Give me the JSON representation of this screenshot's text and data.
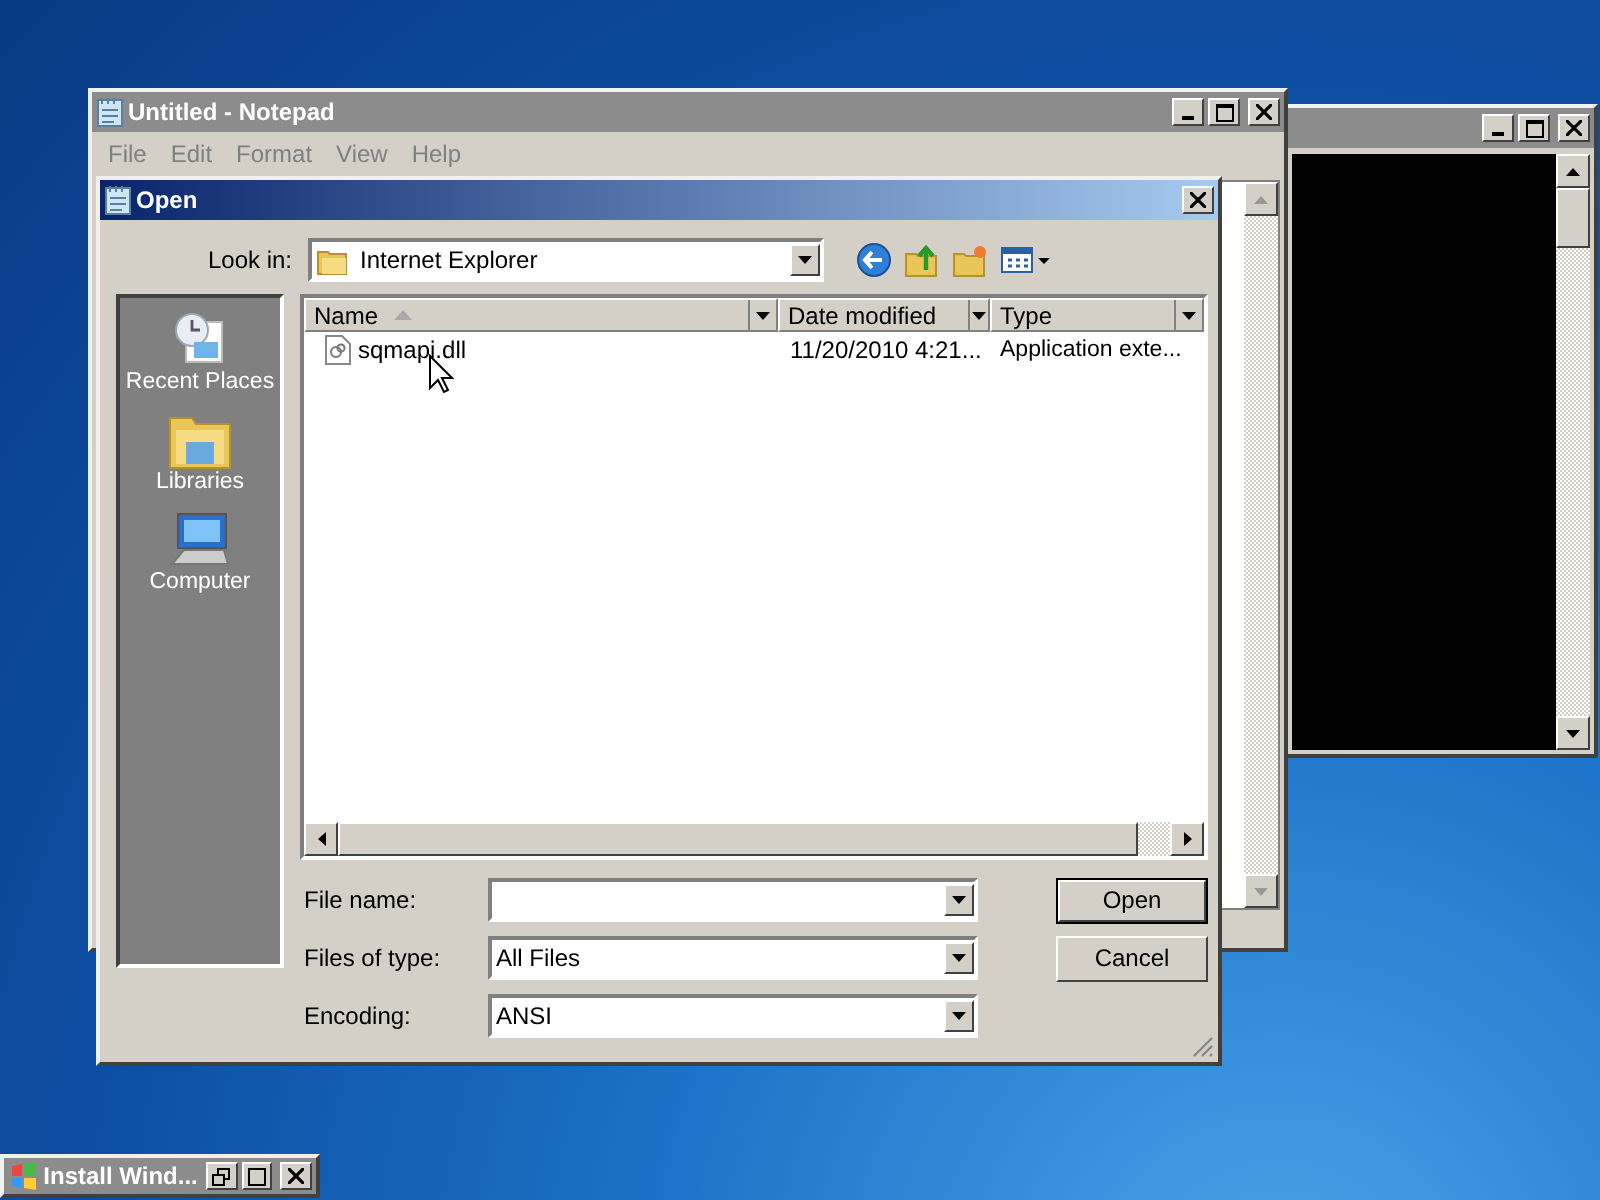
{
  "console_window": {
    "active": false
  },
  "notepad": {
    "title": "Untitled - Notepad",
    "active": false,
    "menu": [
      "File",
      "Edit",
      "Format",
      "View",
      "Help"
    ]
  },
  "open_dialog": {
    "title": "Open",
    "active": true,
    "look_in": {
      "label": "Look in:",
      "value": "Internet Explorer"
    },
    "places": [
      {
        "kind": "recent",
        "label": "Recent Places"
      },
      {
        "kind": "libraries",
        "label": "Libraries"
      },
      {
        "kind": "computer",
        "label": "Computer"
      }
    ],
    "columns": [
      {
        "label": "Name",
        "sorted": true
      },
      {
        "label": "Date modified",
        "sorted": false
      },
      {
        "label": "Type",
        "sorted": false
      }
    ],
    "rows": [
      {
        "name": "sqmapi.dll",
        "date_modified": "11/20/2010 4:21...",
        "type": "Application exte..."
      }
    ],
    "fields": [
      {
        "label": "File name:"
      },
      {
        "label": "Files of type:",
        "value": "All Files"
      },
      {
        "label": "Encoding:",
        "value": "ANSI"
      }
    ],
    "buttons": [
      {
        "label": "Open",
        "default": true
      },
      {
        "label": "Cancel",
        "default": false
      }
    ]
  },
  "taskbar_item": {
    "title": "Install Wind..."
  }
}
